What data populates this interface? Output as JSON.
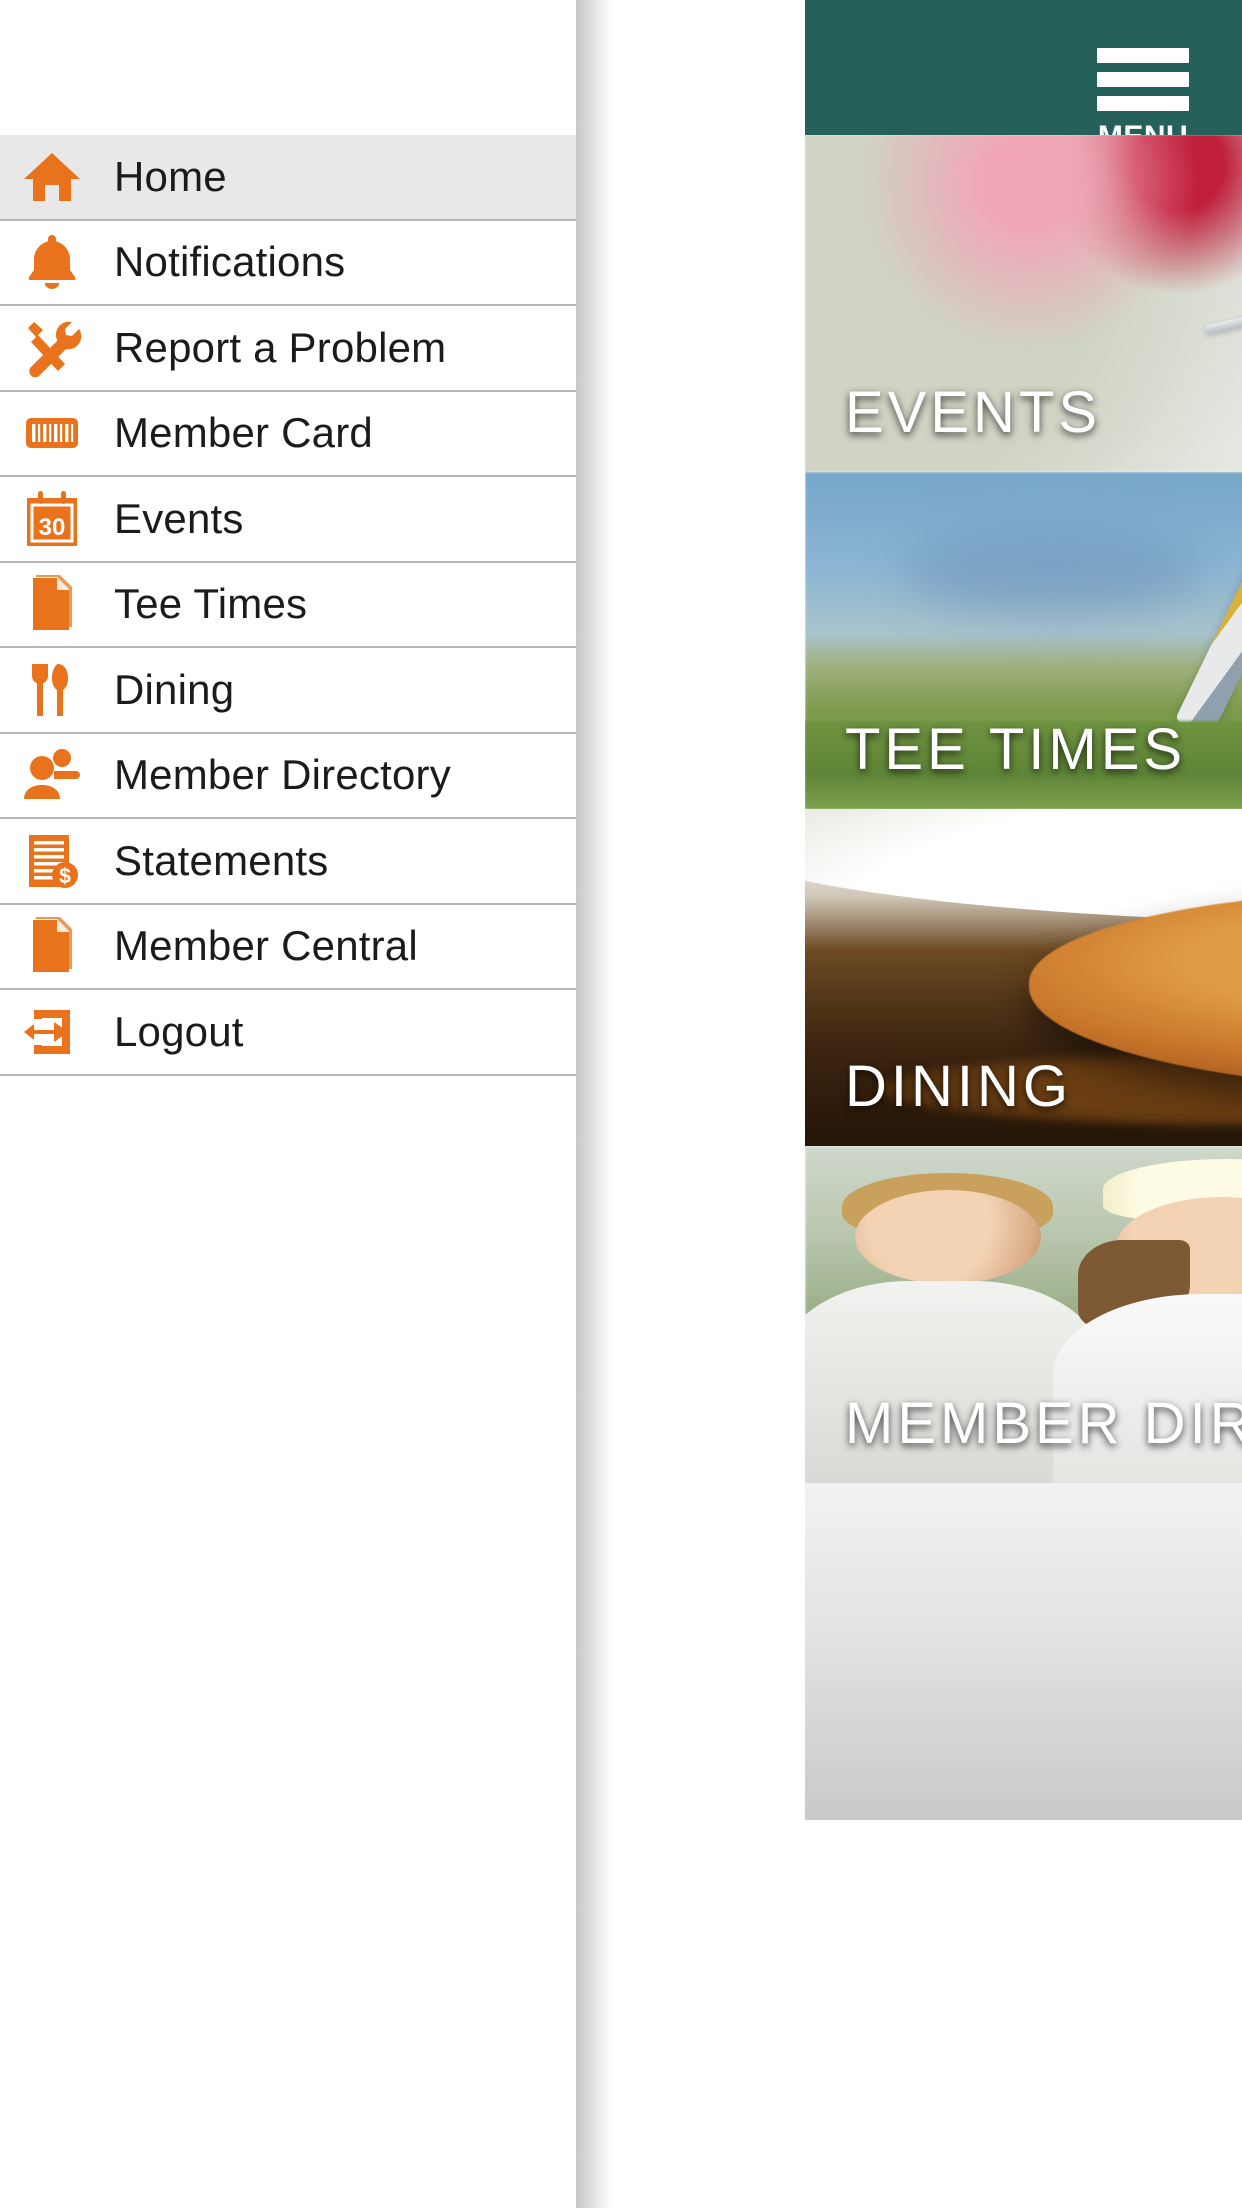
{
  "app": {
    "header": {
      "menu_label": "MENU",
      "hamburger_icon": "hamburger-menu-icon",
      "background_color": "#26605A",
      "battery_icon": "battery-full-icon"
    },
    "tiles": [
      {
        "label": "EVENTS",
        "image": "events-dining-table-photo"
      },
      {
        "label": "TEE TIMES",
        "image": "golf-club-on-green-photo"
      },
      {
        "label": "DINING",
        "image": "plated-entree-photo"
      },
      {
        "label": "MEMBER DIRECTORY",
        "image": "two-members-outdoors-photo"
      },
      {
        "label": "",
        "image": "partial-tile-photo"
      }
    ]
  },
  "drawer": {
    "accent_color": "#E8731C",
    "active_item": "Home",
    "items": [
      {
        "label": "Home",
        "icon": "home-icon",
        "active": true
      },
      {
        "label": "Notifications",
        "icon": "bell-icon",
        "active": false
      },
      {
        "label": "Report a Problem",
        "icon": "hammer-wrench-icon",
        "active": false
      },
      {
        "label": "Member Card",
        "icon": "barcode-icon",
        "active": false
      },
      {
        "label": "Events",
        "icon": "calendar-30-icon",
        "active": false
      },
      {
        "label": "Tee Times",
        "icon": "document-icon",
        "active": false
      },
      {
        "label": "Dining",
        "icon": "fork-knife-icon",
        "active": false
      },
      {
        "label": "Member Directory",
        "icon": "people-icon",
        "active": false
      },
      {
        "label": "Statements",
        "icon": "invoice-dollar-icon",
        "active": false
      },
      {
        "label": "Member Central",
        "icon": "document-icon",
        "active": false
      },
      {
        "label": "Logout",
        "icon": "logout-arrow-icon",
        "active": false
      }
    ]
  }
}
